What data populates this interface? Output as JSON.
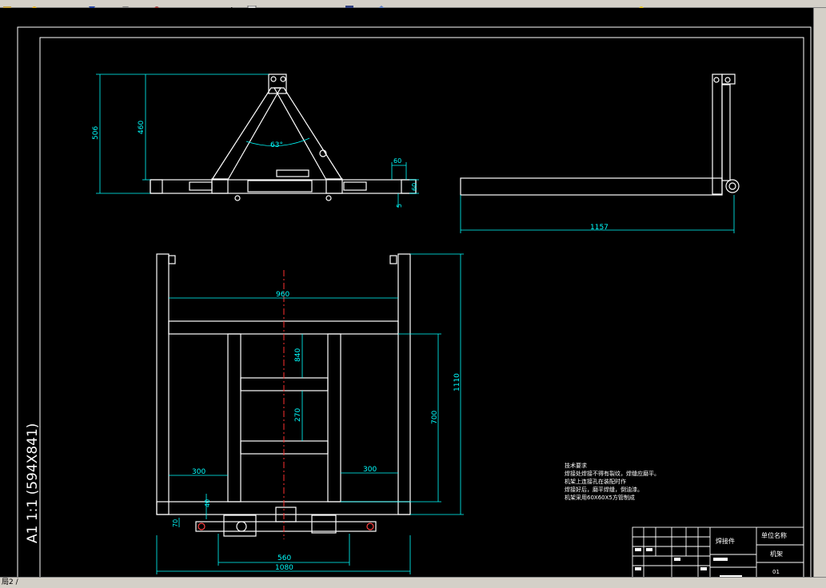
{
  "colors": {
    "frame": "#ffffff",
    "dim": "#00ffff",
    "center": "#ff3030",
    "highlight": "#ff4040",
    "bg": "#000000",
    "note": "#ffffff"
  },
  "toolbar": {
    "icons": [
      "layer-icon",
      "pan-icon",
      "zoom-realtime-icon",
      "zoom-window-icon",
      "zoom-previous-icon",
      "properties-icon",
      "design-center-icon",
      "tool-palette-icon",
      "markup-icon",
      "help-icon"
    ]
  },
  "drawing": {
    "sheet_label": "A1 1:1 (594X841)",
    "front_view": {
      "dims": [
        "506",
        "460",
        "63°",
        "60",
        "60",
        "5"
      ]
    },
    "side_view": {
      "dims": [
        "1157"
      ]
    },
    "top_view": {
      "dims": [
        "960",
        "1110",
        "840",
        "270",
        "700",
        "300",
        "300",
        "40",
        "70",
        "560",
        "1080"
      ]
    },
    "notes": {
      "heading": "技术要求",
      "lines": [
        "焊接处焊接不得有裂纹，焊缝应磨平。",
        "机架上连接孔在装配时作",
        "焊接好后，磨平焊缝，倒油漆。",
        "机架采用60X60X5方管制成"
      ]
    },
    "title_block": {
      "part_name": "焊接件",
      "company": "单位名称",
      "drawing_name": "机架",
      "drawing_no": "01"
    }
  },
  "status": {
    "layout_tab": "局2 /"
  }
}
